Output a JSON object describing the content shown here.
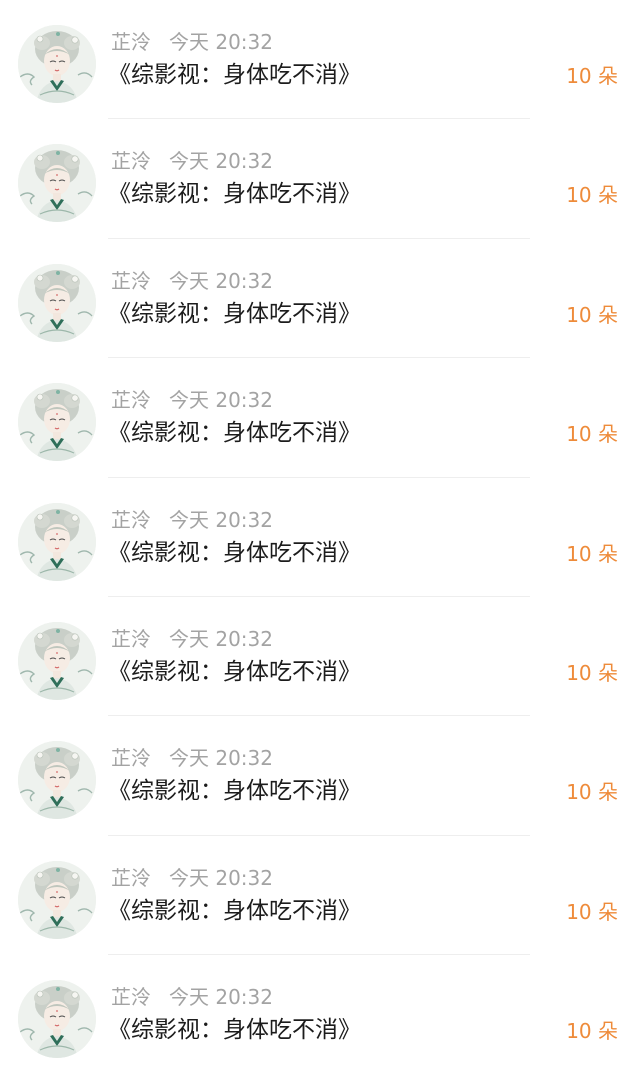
{
  "colors": {
    "accent": "#ee8b3a",
    "meta_text": "#a3a3a3",
    "title_text": "#1c1c1c",
    "divider": "#eeeeee"
  },
  "messages": [
    {
      "name": "芷泠",
      "time": "今天 20:32",
      "title": "《综影视：身体吃不消》",
      "gift": "10 朵",
      "avatar": "girl-portrait-avatar"
    },
    {
      "name": "芷泠",
      "time": "今天 20:32",
      "title": "《综影视：身体吃不消》",
      "gift": "10 朵",
      "avatar": "girl-portrait-avatar"
    },
    {
      "name": "芷泠",
      "time": "今天 20:32",
      "title": "《综影视：身体吃不消》",
      "gift": "10 朵",
      "avatar": "girl-portrait-avatar"
    },
    {
      "name": "芷泠",
      "time": "今天 20:32",
      "title": "《综影视：身体吃不消》",
      "gift": "10 朵",
      "avatar": "girl-portrait-avatar"
    },
    {
      "name": "芷泠",
      "time": "今天 20:32",
      "title": "《综影视：身体吃不消》",
      "gift": "10 朵",
      "avatar": "girl-portrait-avatar"
    },
    {
      "name": "芷泠",
      "time": "今天 20:32",
      "title": "《综影视：身体吃不消》",
      "gift": "10 朵",
      "avatar": "girl-portrait-avatar"
    },
    {
      "name": "芷泠",
      "time": "今天 20:32",
      "title": "《综影视：身体吃不消》",
      "gift": "10 朵",
      "avatar": "girl-portrait-avatar"
    },
    {
      "name": "芷泠",
      "time": "今天 20:32",
      "title": "《综影视：身体吃不消》",
      "gift": "10 朵",
      "avatar": "girl-portrait-avatar"
    },
    {
      "name": "芷泠",
      "time": "今天 20:32",
      "title": "《综影视：身体吃不消》",
      "gift": "10 朵",
      "avatar": "girl-portrait-avatar"
    }
  ]
}
